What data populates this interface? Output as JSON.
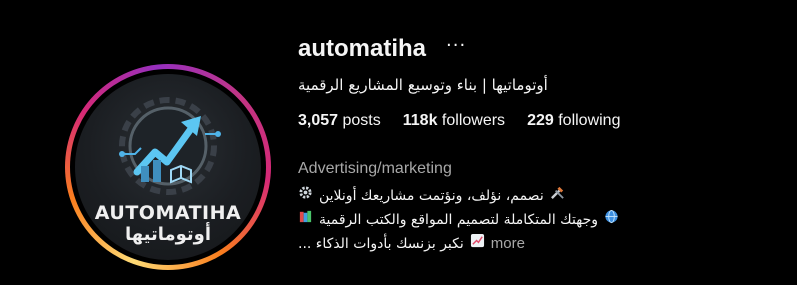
{
  "profile": {
    "username": "automatiha",
    "more_icon": "...",
    "full_name": "أوتوماتيها | بناء وتوسيع المشاريع الرقمية",
    "avatar": {
      "logo_text_en": "AUTOMATIHA",
      "logo_text_ar": "أوتوماتيها"
    },
    "stats": {
      "posts_count": "3,057",
      "posts_label": "posts",
      "followers_count": "118k",
      "followers_label": "followers",
      "following_count": "229",
      "following_label": "following"
    },
    "category": "Advertising/marketing",
    "bio": {
      "line1": "نصمم، نؤلف، ونؤتمت مشاريعك أونلاين",
      "line2": "وجهتك المتكاملة لتصميم المواقع والكتب الرقمية",
      "line3": "نكبر بزنسك بأدوات الذكاء ...",
      "more_label": "more"
    },
    "colors": {
      "background": "#000000",
      "text": "#f5f5f5",
      "muted": "#a8a8a8",
      "ring_gradient": [
        "#feda75",
        "#fa7e1e",
        "#d62976",
        "#962fbf"
      ],
      "logo_accent": "#4fb3e8"
    },
    "icons": {
      "bio_line1_left": "tools-icon",
      "bio_line1_right": "gear-icon",
      "bio_line2_left": "books-icon",
      "bio_line2_right": "globe-icon",
      "bio_line3_left": "chart-up-icon"
    }
  }
}
